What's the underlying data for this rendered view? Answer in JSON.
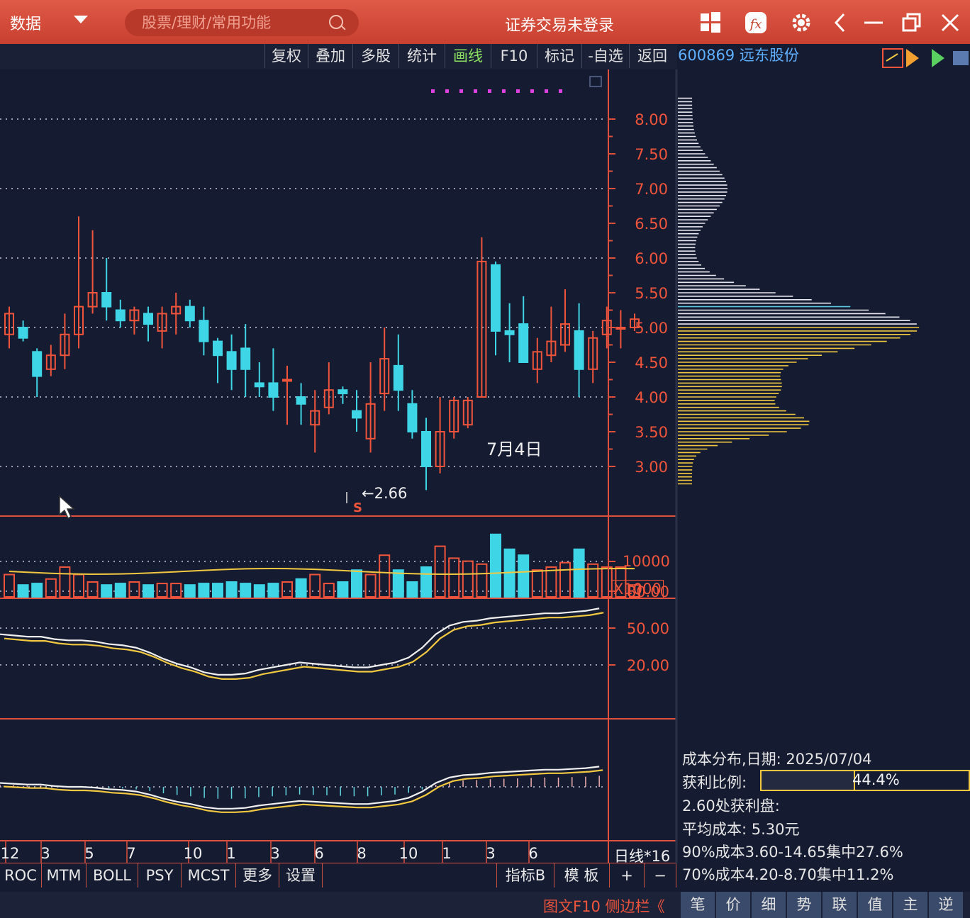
{
  "topbar": {
    "menu_label": "数据",
    "search_placeholder": "股票/理财/常用功能",
    "title": "证券交易未登录"
  },
  "toolbar": {
    "items": [
      "复权",
      "叠加",
      "多股",
      "统计",
      "画线",
      "F10",
      "标记",
      "-自选",
      "返回"
    ],
    "active_index": 4
  },
  "stock": {
    "code_name": "600869 远东股份"
  },
  "chart_data": {
    "type": "candlestick",
    "period": "日线*16",
    "y_ticks": [
      "8.00",
      "7.50",
      "7.00",
      "6.50",
      "6.00",
      "5.50",
      "5.00",
      "4.50",
      "4.00",
      "3.50",
      "3.00"
    ],
    "low_marker": "←2.66",
    "low_flag": "S",
    "annotation": "7月4日",
    "volume": {
      "tick": "10000",
      "unit": "X1000"
    },
    "oscillator": {
      "ticks": [
        "80.00",
        "50.00",
        "20.00"
      ]
    },
    "x_ticks": [
      "12",
      "3",
      "5",
      "7",
      "10",
      "1",
      "3",
      "6",
      "8",
      "10",
      "1",
      "3",
      "6"
    ],
    "candles": [
      [
        4.9,
        5.2,
        4.7,
        5.3
      ],
      [
        5.0,
        4.85,
        4.8,
        5.1
      ],
      [
        4.65,
        4.3,
        4.0,
        4.7
      ],
      [
        4.4,
        4.6,
        4.3,
        4.75
      ],
      [
        4.6,
        4.9,
        4.4,
        5.2
      ],
      [
        4.9,
        5.3,
        4.7,
        6.6
      ],
      [
        5.3,
        5.5,
        5.2,
        6.4
      ],
      [
        5.5,
        5.3,
        5.1,
        6.0
      ],
      [
        5.25,
        5.1,
        5.0,
        5.4
      ],
      [
        5.1,
        5.25,
        4.9,
        5.3
      ],
      [
        5.2,
        5.05,
        4.8,
        5.3
      ],
      [
        4.95,
        5.2,
        4.7,
        5.3
      ],
      [
        5.2,
        5.3,
        4.9,
        5.5
      ],
      [
        5.3,
        5.1,
        5.0,
        5.4
      ],
      [
        5.1,
        4.8,
        4.6,
        5.3
      ],
      [
        4.8,
        4.6,
        4.2,
        4.85
      ],
      [
        4.65,
        4.4,
        4.1,
        4.9
      ],
      [
        4.7,
        4.4,
        4.0,
        5.05
      ],
      [
        4.2,
        4.15,
        4.0,
        4.5
      ],
      [
        4.2,
        4.0,
        3.8,
        4.7
      ],
      [
        4.25,
        4.25,
        3.6,
        4.45
      ],
      [
        4.0,
        3.9,
        3.6,
        4.2
      ],
      [
        3.6,
        3.8,
        3.2,
        4.1
      ],
      [
        3.85,
        4.1,
        3.75,
        4.5
      ],
      [
        4.1,
        4.05,
        3.9,
        4.15
      ],
      [
        3.8,
        3.7,
        3.5,
        4.1
      ],
      [
        3.4,
        3.9,
        3.2,
        4.5
      ],
      [
        4.05,
        4.55,
        3.8,
        5.0
      ],
      [
        4.45,
        4.1,
        3.8,
        4.9
      ],
      [
        3.9,
        3.5,
        3.4,
        4.1
      ],
      [
        3.5,
        3.0,
        2.66,
        3.7
      ],
      [
        3.0,
        3.5,
        2.9,
        4.0
      ],
      [
        3.5,
        3.95,
        3.4,
        4.0
      ],
      [
        3.6,
        3.95,
        3.55,
        4.0
      ],
      [
        4.0,
        5.95,
        4.0,
        6.3
      ],
      [
        5.9,
        4.95,
        4.6,
        5.95
      ],
      [
        4.95,
        4.9,
        4.5,
        5.35
      ],
      [
        5.05,
        4.5,
        4.5,
        5.45
      ],
      [
        4.4,
        4.65,
        4.2,
        4.85
      ],
      [
        4.6,
        4.8,
        4.5,
        5.3
      ],
      [
        4.75,
        5.05,
        4.65,
        5.55
      ],
      [
        4.95,
        4.4,
        4.0,
        5.35
      ],
      [
        4.4,
        4.85,
        4.2,
        4.95
      ],
      [
        4.9,
        5.1,
        4.7,
        5.3
      ],
      [
        5.0,
        5.0,
        4.7,
        5.25
      ],
      [
        5.0,
        5.12,
        4.95,
        5.2
      ]
    ],
    "volumes": [
      15,
      8,
      9,
      12,
      20,
      15,
      10,
      8,
      9,
      10,
      8,
      9,
      9,
      8,
      9,
      9,
      10,
      9,
      8,
      9,
      10,
      12,
      15,
      9,
      10,
      18,
      15,
      28,
      18,
      10,
      20,
      34,
      26,
      24,
      22,
      42,
      32,
      28,
      18,
      20,
      23,
      32,
      22,
      20,
      20,
      8
    ],
    "osc_line": [
      45,
      44,
      43,
      43,
      41,
      40,
      40,
      39,
      37,
      36,
      34,
      30,
      25,
      21,
      18,
      14,
      12,
      12,
      13,
      16,
      18,
      20,
      22,
      21,
      20,
      19,
      18,
      18,
      20,
      22,
      26,
      34,
      45,
      52,
      55,
      56,
      58,
      59,
      60,
      61,
      62,
      62,
      63,
      64,
      66
    ]
  },
  "volume_profile_colors": {
    "profit": "#f2c840",
    "loss": "#e8e8f0",
    "avg": "#5fc8e0"
  },
  "cost_panel": {
    "date": "成本分布,日期: 2025/07/04",
    "profit_ratio_label": "获利比例:",
    "profit_ratio_value": "44.4%",
    "profit_ratio": 0.444,
    "profit_at": "2.60处获利盘:",
    "avg_cost": "平均成本: 5.30元",
    "cost90": "90%成本3.60-14.65集中27.6%",
    "cost70": "70%成本4.20-8.70集中11.2%"
  },
  "bottom_tabs": [
    "ROC",
    "MTM",
    "BOLL",
    "PSY",
    "MCST",
    "更多",
    "设置"
  ],
  "bottom_right": {
    "indicator": "指标B",
    "template": "模 板",
    "plus": "+",
    "minus": "−"
  },
  "status": {
    "sidebar": "图文F10 侧边栏《",
    "buttons": [
      "笔",
      "价",
      "细",
      "势",
      "联",
      "值",
      "主",
      "逆"
    ]
  },
  "colors": {
    "up": "#f0553c",
    "down": "#3ed6e6",
    "grid": "#c8c8d8",
    "border": "#e0503c"
  }
}
